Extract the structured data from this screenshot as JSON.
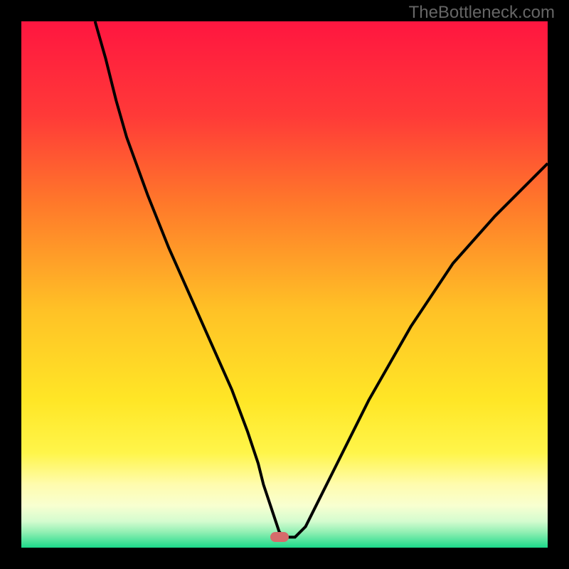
{
  "watermark": "TheBottleneck.com",
  "chart_data": {
    "type": "line",
    "title": "",
    "xlabel": "",
    "ylabel": "",
    "xlim": [
      0,
      100
    ],
    "ylim": [
      0,
      100
    ],
    "grid": false,
    "legend": false,
    "marker": {
      "x": 49,
      "y": 2
    },
    "colors": {
      "top": "#ff1640",
      "mid1": "#ff6a2a",
      "mid2": "#ffde26",
      "mid3": "#fffb9e",
      "bottom": "#1cd98a",
      "curve": "#000000",
      "marker": "#d66b6b"
    },
    "series": [
      {
        "name": "curve",
        "x": [
          14,
          16,
          18,
          20,
          24,
          28,
          32,
          36,
          40,
          43,
          45,
          46,
          47,
          48,
          49,
          50,
          51,
          52,
          54,
          56,
          60,
          66,
          74,
          82,
          90,
          98,
          100
        ],
        "values": [
          100,
          93,
          85,
          78,
          67,
          57,
          48,
          39,
          30,
          22,
          16,
          12,
          9,
          6,
          3,
          2,
          2,
          2,
          4,
          8,
          16,
          28,
          42,
          54,
          63,
          71,
          73
        ]
      }
    ]
  }
}
